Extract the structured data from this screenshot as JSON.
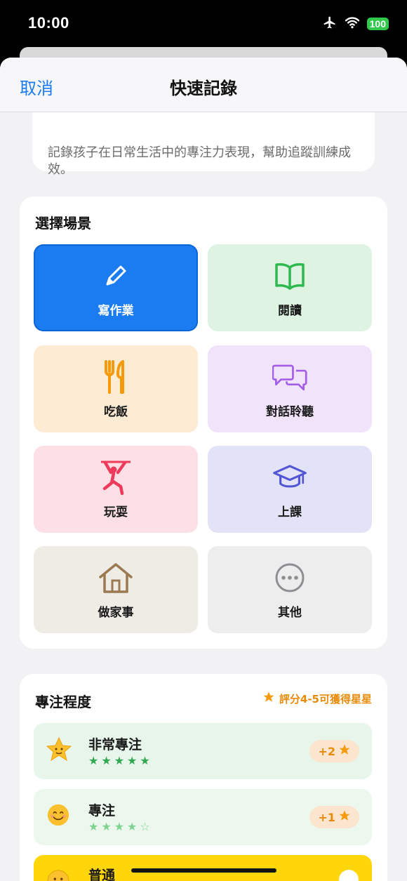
{
  "status": {
    "time": "10:00",
    "battery": "100"
  },
  "nav": {
    "cancel": "取消",
    "title": "快速記錄"
  },
  "intro": {
    "description": "記錄孩子在日常生活中的專注力表現，幫助追蹤訓練成效。"
  },
  "scene": {
    "title": "選擇場景",
    "tiles": [
      {
        "label": "寫作業",
        "icon": "pencil-icon",
        "selected": true
      },
      {
        "label": "閱讀",
        "icon": "book-icon",
        "color": "#2fb84f"
      },
      {
        "label": "吃飯",
        "icon": "fork-knife-icon",
        "color": "#f59a0a"
      },
      {
        "label": "對話聆聽",
        "icon": "chat-bubbles-icon",
        "color": "#a35ee8"
      },
      {
        "label": "玩耍",
        "icon": "playing-figure-icon",
        "color": "#ee3b5b"
      },
      {
        "label": "上課",
        "icon": "graduation-cap-icon",
        "color": "#5256d6"
      },
      {
        "label": "做家事",
        "icon": "house-icon",
        "color": "#9b7a52"
      },
      {
        "label": "其他",
        "icon": "more-dots-icon",
        "color": "#8e8e93"
      }
    ]
  },
  "focus": {
    "title": "專注程度",
    "hint": "評分4-5可獲得星星",
    "levels": [
      {
        "name": "非常專注",
        "stars": "★★★★★",
        "bonus": "+2"
      },
      {
        "name": "專注",
        "stars": "★★★★☆",
        "bonus": "+1"
      },
      {
        "name": "普通"
      }
    ]
  },
  "colors": {
    "accent": "#1b7cf2",
    "star": "#f59a0a",
    "green": "#2fa84f"
  }
}
